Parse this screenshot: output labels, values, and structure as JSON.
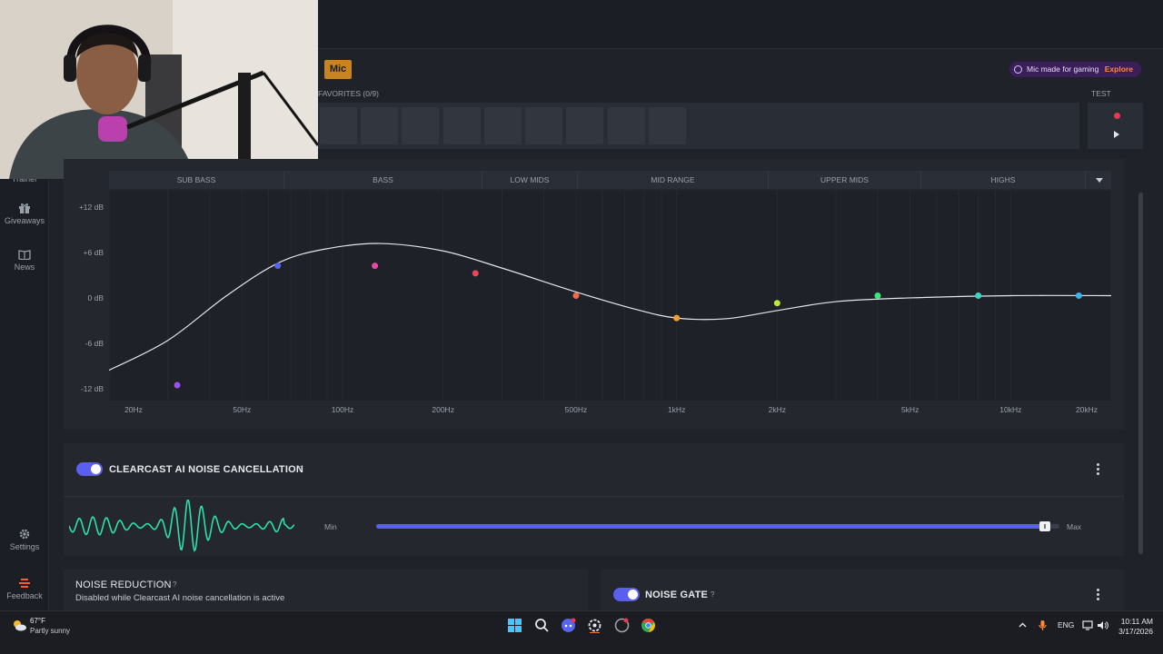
{
  "nav": {
    "trainer_label": "Trainer",
    "giveaways_label": "Giveaways",
    "news_label": "News",
    "settings_label": "Settings",
    "feedback_label": "Feedback"
  },
  "device": {
    "tab_label": "Mic",
    "promo_text": "Mic made for gaming",
    "promo_link": "Explore",
    "favorites_label": "FAVORITES (0/9)",
    "test_label": "TEST"
  },
  "equalizer": {
    "bands": [
      "SUB BASS",
      "BASS",
      "LOW MIDS",
      "MID RANGE",
      "UPPER MIDS",
      "HIGHS"
    ],
    "y_ticks": [
      "+12 dB",
      "+6 dB",
      "0 dB",
      "-6 dB",
      "-12 dB"
    ],
    "x_ticks": [
      "20Hz",
      "50Hz",
      "100Hz",
      "200Hz",
      "500Hz",
      "1kHz",
      "2kHz",
      "5kHz",
      "10kHz",
      "20kHz"
    ]
  },
  "chart_data": {
    "type": "line",
    "xlabel": "",
    "ylabel": "",
    "x_scale": "log",
    "xlim": [
      20,
      20000
    ],
    "ylim": [
      -12,
      12
    ],
    "x_ticks": [
      "20Hz",
      "50Hz",
      "100Hz",
      "200Hz",
      "500Hz",
      "1kHz",
      "2kHz",
      "5kHz",
      "10kHz",
      "20kHz"
    ],
    "y_ticks": [
      "+12 dB",
      "+6 dB",
      "0 dB",
      "-6 dB",
      "-12 dB"
    ],
    "grid": true,
    "points": [
      {
        "hz": 32,
        "db": -12,
        "color": "#9a52f0"
      },
      {
        "hz": 64,
        "db": 4,
        "color": "#5860f0"
      },
      {
        "hz": 125,
        "db": 4,
        "color": "#e84aa0"
      },
      {
        "hz": 250,
        "db": 3,
        "color": "#e8485a"
      },
      {
        "hz": 500,
        "db": 0,
        "color": "#f06a4a"
      },
      {
        "hz": 1000,
        "db": -3,
        "color": "#f0a030"
      },
      {
        "hz": 2000,
        "db": -1,
        "color": "#b8e83a"
      },
      {
        "hz": 4000,
        "db": 0,
        "color": "#3ae87a"
      },
      {
        "hz": 8000,
        "db": 0,
        "color": "#34d8c8"
      },
      {
        "hz": 16000,
        "db": 0,
        "color": "#38b4f0"
      }
    ],
    "curve": [
      {
        "hz": 20,
        "db": -10
      },
      {
        "hz": 30,
        "db": -6
      },
      {
        "hz": 45,
        "db": 0
      },
      {
        "hz": 65,
        "db": 4.5
      },
      {
        "hz": 90,
        "db": 6.3
      },
      {
        "hz": 130,
        "db": 7
      },
      {
        "hz": 200,
        "db": 6
      },
      {
        "hz": 300,
        "db": 3.7
      },
      {
        "hz": 500,
        "db": 0.5
      },
      {
        "hz": 750,
        "db": -1.8
      },
      {
        "hz": 1000,
        "db": -3
      },
      {
        "hz": 1400,
        "db": -3.1
      },
      {
        "hz": 2000,
        "db": -2
      },
      {
        "hz": 3000,
        "db": -0.8
      },
      {
        "hz": 5000,
        "db": -0.3
      },
      {
        "hz": 10000,
        "db": 0
      },
      {
        "hz": 20000,
        "db": 0
      }
    ]
  },
  "clearcast": {
    "enabled": true,
    "title": "CLEARCAST AI NOISE CANCELLATION",
    "help": "?",
    "slider_min": "Min",
    "slider_max": "Max",
    "slider_level": 0.98,
    "wave_color": "#2ee0a8"
  },
  "noise_reduction": {
    "title": "NOISE REDUCTION",
    "help": "?",
    "description": "Disabled while Clearcast AI noise cancellation is active"
  },
  "noise_gate": {
    "enabled": true,
    "title": "NOISE GATE",
    "help": "?"
  },
  "taskbar": {
    "weather_temp": "67°F",
    "weather_desc": "Partly sunny",
    "language": "ENG",
    "time": "10:11 AM",
    "date": "3/17/2026",
    "icons": [
      "windows-start-icon",
      "search-icon",
      "discord-icon",
      "steelseries-gg-icon",
      "app-icon",
      "chrome-icon"
    ]
  },
  "colors": {
    "accent": "#5a5ff0",
    "mic_tab": "#c8841f",
    "feedback": "#ff5a2a",
    "promo_link": "#ff8a3d"
  }
}
